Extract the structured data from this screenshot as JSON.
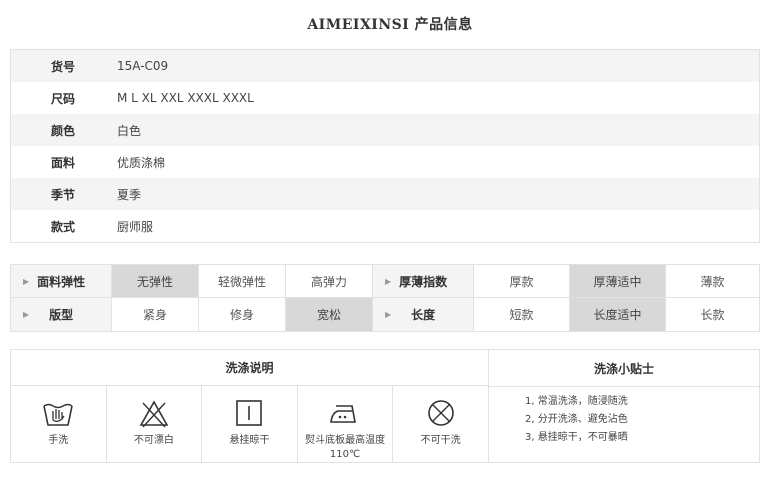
{
  "title": "AIMEIXINSI 产品信息",
  "info": [
    {
      "label": "货号",
      "value": "15A-C09"
    },
    {
      "label": "尺码",
      "value": "M L XL XXL XXXL XXXL"
    },
    {
      "label": "颜色",
      "value": "白色"
    },
    {
      "label": "面料",
      "value": "优质涤棉"
    },
    {
      "label": "季节",
      "value": "夏季"
    },
    {
      "label": "款式",
      "value": "厨师服"
    }
  ],
  "attributes": {
    "elasticity": {
      "label": "面料弹性",
      "options": [
        "无弹性",
        "轻微弹性",
        "高弹力"
      ],
      "selected": "无弹性"
    },
    "thickness": {
      "label": "厚薄指数",
      "options": [
        "厚款",
        "厚薄适中",
        "薄款"
      ],
      "selected": "厚薄适中"
    },
    "fit": {
      "label": "版型",
      "options": [
        "紧身",
        "修身",
        "宽松"
      ],
      "selected": "宽松"
    },
    "length": {
      "label": "长度",
      "options": [
        "短款",
        "长度适中",
        "长款"
      ],
      "selected": "长度适中"
    }
  },
  "care": {
    "header": "洗涤说明",
    "items": [
      {
        "icon": "hand-wash-icon",
        "label": "手洗"
      },
      {
        "icon": "no-bleach-icon",
        "label": "不可漂白"
      },
      {
        "icon": "hang-dry-icon",
        "label": "悬挂晾干"
      },
      {
        "icon": "iron-icon",
        "label": "熨斗底板最高温度110℃"
      },
      {
        "icon": "no-dry-clean-icon",
        "label": "不可干洗"
      }
    ]
  },
  "tips": {
    "header": "洗涤小贴士",
    "lines": [
      "1, 常温洗涤，随浸随洗",
      "2, 分开洗涤、避免沾色",
      "3, 悬挂晾干，不可暴晒"
    ]
  },
  "colors": {
    "border": "#e2e2e2",
    "row_alt": "#f4f4f4",
    "selected": "#d8d8d8"
  }
}
